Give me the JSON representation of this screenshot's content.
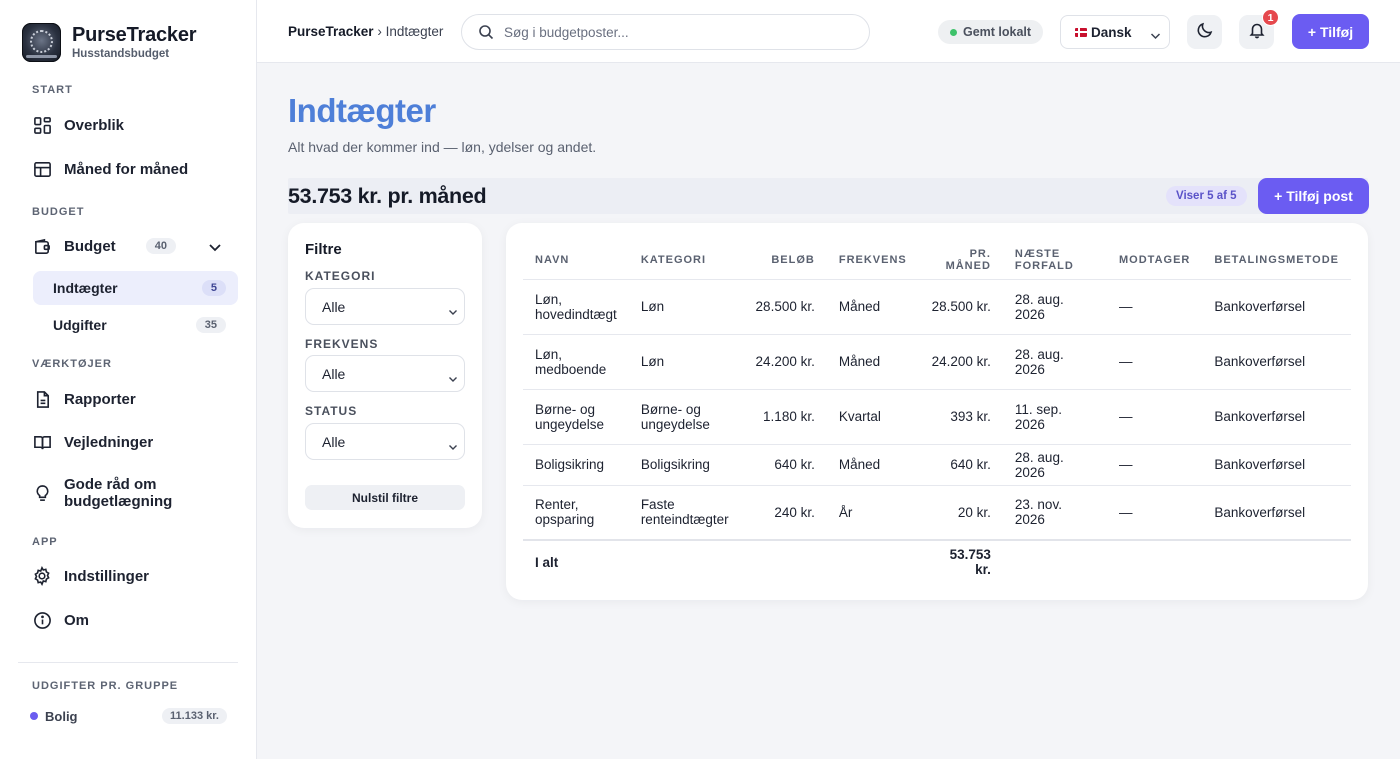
{
  "app": {
    "name": "PurseTracker",
    "subtitle": "Husstandsbudget"
  },
  "sidebar": {
    "sections": {
      "start": "START",
      "budget": "BUDGET",
      "tools": "VÆRKTØJER",
      "app": "APP",
      "groups": "UDGIFTER PR. GRUPPE"
    },
    "overview": "Overblik",
    "monthly": "Måned for måned",
    "budget": {
      "label": "Budget",
      "count": "40"
    },
    "income": {
      "label": "Indtægter",
      "count": "5"
    },
    "expenses": {
      "label": "Udgifter",
      "count": "35"
    },
    "reports": "Rapporter",
    "guides": "Vejledninger",
    "tips_line1": "Gode råd om",
    "tips_line2": "budgetlægning",
    "settings": "Indstillinger",
    "about": "Om",
    "group": {
      "name": "Bolig",
      "value": "11.133 kr.",
      "color": "#6a5cf0"
    }
  },
  "header": {
    "breadcrumb_root": "PurseTracker",
    "breadcrumb_sep": " › ",
    "breadcrumb_page": "Indtægter",
    "search_placeholder": "Søg i budgetposter...",
    "saved_status": "Gemt lokalt",
    "language": "Dansk",
    "notifications": "1",
    "add_label": "+ Tilføj"
  },
  "main": {
    "title": "Indtægter",
    "subtitle": "Alt hvad der kommer ind — løn, ydelser og andet.",
    "monthly_total": "53.753 kr. pr. måned",
    "showing": "Viser 5 af 5",
    "add_post": "+ Tilføj post"
  },
  "filters": {
    "title": "Filtre",
    "category_label": "KATEGORI",
    "category_value": "Alle",
    "frequency_label": "FREKVENS",
    "frequency_value": "Alle",
    "status_label": "STATUS",
    "status_value": "Alle",
    "reset": "Nulstil filtre"
  },
  "table": {
    "headers": {
      "name": "NAVN",
      "category": "KATEGORI",
      "amount": "BELØB",
      "frequency": "FREKVENS",
      "monthly": "PR. MÅNED",
      "due": "NÆSTE FORFALD",
      "recipient": "MODTAGER",
      "method": "BETALINGSMETODE"
    },
    "rows": [
      {
        "name1": "Løn,",
        "name2": "hovedindtægt",
        "cat1": "Løn",
        "cat2": "",
        "amount": "28.500 kr.",
        "frequency": "Måned",
        "monthly": "28.500 kr.",
        "due": "28. aug. 2026",
        "recipient": "—",
        "method": "Bankoverførsel"
      },
      {
        "name1": "Løn,",
        "name2": "medboende",
        "cat1": "Løn",
        "cat2": "",
        "amount": "24.200 kr.",
        "frequency": "Måned",
        "monthly": "24.200 kr.",
        "due": "28. aug. 2026",
        "recipient": "—",
        "method": "Bankoverførsel"
      },
      {
        "name1": "Børne- og",
        "name2": "ungeydelse",
        "cat1": "Børne- og",
        "cat2": "ungeydelse",
        "amount": "1.180 kr.",
        "frequency": "Kvartal",
        "monthly": "393 kr.",
        "due": "11. sep. 2026",
        "recipient": "—",
        "method": "Bankoverførsel"
      },
      {
        "name1": "Boligsikring",
        "name2": "",
        "cat1": "Boligsikring",
        "cat2": "",
        "amount": "640 kr.",
        "frequency": "Måned",
        "monthly": "640 kr.",
        "due": "28. aug. 2026",
        "recipient": "—",
        "method": "Bankoverførsel"
      },
      {
        "name1": "Renter,",
        "name2": "opsparing",
        "cat1": "Faste",
        "cat2": "renteindtægter",
        "amount": "240 kr.",
        "frequency": "År",
        "monthly": "20 kr.",
        "due": "23. nov. 2026",
        "recipient": "—",
        "method": "Bankoverførsel"
      }
    ],
    "total_label": "I alt",
    "total_monthly": "53.753 kr."
  },
  "colors": {
    "accent": "#6b5cf2",
    "title": "#4e7fd8",
    "status_green": "#3ec26b",
    "badge_red": "#e5484d"
  }
}
